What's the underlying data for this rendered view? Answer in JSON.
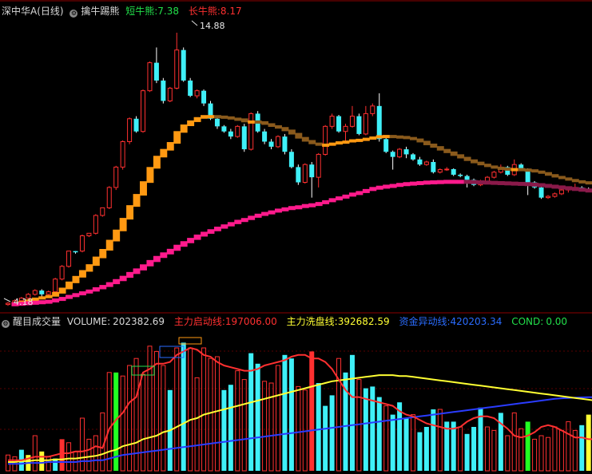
{
  "top_header": {
    "stock_name": "深中华A(日线)",
    "indicator_name": "擒牛踢熊",
    "short_label": "短牛熊:",
    "short_value": "7.38",
    "long_label": "长牛熊:",
    "long_value": "8.17"
  },
  "bottom_header": {
    "indicator_name": "醒目成交量",
    "volume_label": "VOLUME:",
    "volume_value": "202382.69",
    "start_label": "主力启动线:",
    "start_value": "197006.00",
    "wash_label": "主力洗盘线:",
    "wash_value": "392682.59",
    "fund_label": "资金异动线:",
    "fund_value": "420203.34",
    "cond_label": "COND:",
    "cond_value": "0.00"
  },
  "price_annotations": {
    "high": "14.88",
    "low": "4.18"
  },
  "colors": {
    "up": "#ff3030",
    "down": "#3ff0f8",
    "orange": "#ff9912",
    "brown": "#8a5a1c",
    "pink": "#ff1a8c",
    "maroon": "#8a1a4a",
    "yellow": "#ffff33",
    "blue": "#2a3cff",
    "green": "#22ff22"
  },
  "chart_data": [
    {
      "type": "candlestick",
      "price_range": [
        4.0,
        15.6
      ],
      "candles": [
        [
          4.2,
          4.25,
          4.15,
          4.3
        ],
        [
          4.25,
          4.35,
          4.2,
          4.4
        ],
        [
          4.35,
          4.45,
          4.3,
          4.5
        ],
        [
          4.45,
          4.6,
          4.4,
          4.65
        ],
        [
          4.6,
          4.75,
          4.55,
          4.8
        ],
        [
          4.75,
          4.6,
          4.5,
          4.8
        ],
        [
          4.6,
          4.7,
          4.55,
          4.75
        ],
        [
          4.7,
          5.2,
          4.65,
          5.25
        ],
        [
          5.2,
          5.7,
          5.15,
          5.75
        ],
        [
          5.7,
          6.3,
          5.65,
          6.3
        ],
        [
          6.3,
          6.25,
          6.2,
          6.3
        ],
        [
          6.3,
          6.9,
          6.25,
          6.95
        ],
        [
          6.9,
          7.0,
          6.85,
          7.0
        ],
        [
          7.0,
          7.7,
          6.95,
          7.75
        ],
        [
          7.7,
          8.0,
          7.65,
          8.0
        ],
        [
          8.0,
          8.8,
          7.95,
          8.85
        ],
        [
          8.8,
          9.6,
          8.7,
          9.65
        ],
        [
          9.6,
          10.6,
          9.5,
          10.65
        ],
        [
          10.6,
          11.5,
          10.5,
          11.55
        ],
        [
          11.5,
          11.0,
          10.95,
          11.6
        ],
        [
          11.0,
          12.6,
          10.95,
          12.65
        ],
        [
          12.6,
          13.7,
          12.55,
          13.75
        ],
        [
          13.7,
          13.0,
          12.9,
          14.3
        ],
        [
          13.0,
          12.2,
          12.1,
          13.1
        ],
        [
          12.2,
          12.7,
          12.15,
          12.75
        ],
        [
          12.7,
          14.2,
          12.65,
          14.88
        ],
        [
          14.2,
          13.0,
          12.95,
          14.3
        ],
        [
          13.0,
          12.4,
          12.35,
          13.1
        ],
        [
          12.4,
          12.6,
          12.3,
          12.65
        ],
        [
          12.6,
          12.1,
          12.0,
          12.65
        ],
        [
          12.1,
          11.5,
          11.45,
          12.2
        ],
        [
          11.5,
          11.2,
          11.1,
          11.55
        ],
        [
          11.2,
          11.0,
          10.95,
          11.25
        ],
        [
          11.0,
          10.8,
          10.7,
          11.1
        ],
        [
          10.8,
          11.2,
          10.75,
          11.25
        ],
        [
          11.2,
          10.3,
          10.2,
          11.3
        ],
        [
          10.3,
          11.7,
          10.25,
          11.75
        ],
        [
          11.7,
          11.0,
          10.95,
          11.8
        ],
        [
          11.0,
          10.6,
          10.5,
          11.1
        ],
        [
          10.6,
          10.4,
          10.3,
          10.7
        ],
        [
          10.4,
          10.8,
          10.35,
          10.85
        ],
        [
          10.8,
          10.2,
          10.1,
          10.9
        ],
        [
          10.2,
          9.6,
          9.55,
          10.3
        ],
        [
          9.6,
          9.0,
          8.9,
          9.7
        ],
        [
          9.0,
          9.7,
          8.95,
          9.75
        ],
        [
          9.7,
          9.2,
          8.4,
          9.8
        ],
        [
          9.2,
          10.1,
          8.8,
          10.15
        ],
        [
          10.1,
          11.2,
          10.05,
          11.25
        ],
        [
          11.2,
          11.6,
          11.1,
          11.7
        ],
        [
          11.6,
          11.0,
          10.95,
          11.65
        ],
        [
          11.0,
          11.2,
          10.6,
          11.3
        ],
        [
          11.2,
          11.6,
          11.15,
          12.0
        ],
        [
          11.6,
          10.9,
          10.85,
          11.7
        ],
        [
          10.9,
          11.7,
          10.85,
          12.0
        ],
        [
          11.7,
          12.0,
          11.6,
          12.1
        ],
        [
          12.0,
          10.7,
          10.6,
          12.5
        ],
        [
          10.7,
          10.2,
          10.15,
          10.8
        ],
        [
          10.2,
          10.0,
          9.5,
          10.25
        ],
        [
          10.0,
          10.3,
          9.95,
          10.35
        ],
        [
          10.3,
          10.1,
          9.95,
          10.4
        ],
        [
          10.1,
          9.9,
          9.85,
          10.15
        ],
        [
          9.9,
          9.7,
          9.65,
          10.0
        ],
        [
          9.7,
          9.8,
          9.65,
          9.85
        ],
        [
          9.8,
          9.4,
          9.35,
          9.9
        ],
        [
          9.4,
          9.5,
          9.35,
          9.55
        ],
        [
          9.5,
          9.52,
          9.45,
          9.6
        ],
        [
          9.52,
          9.3,
          9.25,
          9.55
        ],
        [
          9.3,
          9.25,
          9.2,
          9.35
        ],
        [
          9.25,
          9.1,
          8.8,
          9.3
        ],
        [
          9.1,
          8.9,
          8.85,
          9.15
        ],
        [
          8.9,
          9.05,
          8.85,
          9.1
        ],
        [
          9.05,
          9.2,
          9.0,
          9.25
        ],
        [
          9.2,
          9.4,
          9.15,
          9.45
        ],
        [
          9.4,
          9.6,
          9.35,
          9.7
        ],
        [
          9.6,
          9.3,
          9.25,
          9.65
        ],
        [
          9.3,
          9.7,
          9.25,
          9.9
        ],
        [
          9.7,
          9.5,
          9.45,
          9.75
        ],
        [
          9.5,
          9.0,
          8.5,
          9.55
        ],
        [
          9.0,
          8.8,
          8.75,
          9.05
        ],
        [
          8.8,
          8.4,
          8.35,
          8.85
        ],
        [
          8.4,
          8.45,
          8.35,
          8.5
        ],
        [
          8.45,
          8.55,
          8.4,
          8.6
        ],
        [
          8.55,
          8.7,
          8.5,
          8.75
        ],
        [
          8.7,
          8.75,
          8.6,
          8.8
        ],
        [
          8.75,
          8.8,
          8.7,
          8.95
        ],
        [
          8.8,
          8.75,
          8.7,
          8.85
        ],
        [
          8.75,
          8.7,
          8.65,
          8.8
        ],
        [
          8.7,
          8.72,
          8.6,
          8.8
        ]
      ],
      "short_line": [
        4.2,
        4.23,
        4.28,
        4.34,
        4.41,
        4.46,
        4.51,
        4.63,
        4.8,
        5.04,
        5.26,
        5.49,
        5.72,
        6.02,
        6.32,
        6.68,
        7.08,
        7.54,
        8.04,
        8.48,
        8.98,
        9.54,
        9.98,
        10.25,
        10.52,
        10.95,
        11.21,
        11.37,
        11.5,
        11.58,
        11.58,
        11.56,
        11.53,
        11.48,
        11.45,
        11.36,
        11.37,
        11.34,
        11.26,
        11.18,
        11.11,
        11.01,
        10.88,
        10.72,
        10.6,
        10.5,
        10.45,
        10.46,
        10.5,
        10.55,
        10.58,
        10.63,
        10.65,
        10.69,
        10.74,
        10.79,
        10.8,
        10.78,
        10.76,
        10.72,
        10.66,
        10.57,
        10.46,
        10.36,
        10.25,
        10.15,
        10.04,
        9.94,
        9.84,
        9.75,
        9.67,
        9.6,
        9.55,
        9.52,
        9.5,
        9.5,
        9.48,
        9.45,
        9.4,
        9.34,
        9.26,
        9.19,
        9.13,
        9.07,
        9.02,
        8.98,
        8.94,
        8.91
      ],
      "long_line": [
        4.2,
        4.21,
        4.23,
        4.25,
        4.27,
        4.29,
        4.31,
        4.36,
        4.42,
        4.5,
        4.57,
        4.64,
        4.71,
        4.8,
        4.89,
        5.0,
        5.12,
        5.25,
        5.4,
        5.54,
        5.7,
        5.87,
        6.03,
        6.17,
        6.31,
        6.47,
        6.61,
        6.74,
        6.87,
        6.98,
        7.08,
        7.18,
        7.27,
        7.36,
        7.45,
        7.52,
        7.61,
        7.69,
        7.76,
        7.82,
        7.89,
        7.94,
        7.99,
        8.02,
        8.07,
        8.1,
        8.15,
        8.22,
        8.3,
        8.37,
        8.44,
        8.52,
        8.58,
        8.66,
        8.74,
        8.79,
        8.83,
        8.86,
        8.9,
        8.93,
        8.95,
        8.97,
        8.99,
        9.0,
        9.01,
        9.02,
        9.02,
        9.02,
        9.01,
        9.0,
        8.99,
        8.98,
        8.97,
        8.96,
        8.95,
        8.94,
        8.93,
        8.91,
        8.89,
        8.86,
        8.83,
        8.8,
        8.77,
        8.74,
        8.71,
        8.68,
        8.65,
        8.62
      ]
    },
    {
      "type": "bar",
      "volume_range": [
        0,
        800000
      ],
      "volumes": [
        90000,
        80000,
        120000,
        90000,
        200000,
        110000,
        80000,
        70000,
        180000,
        160000,
        110000,
        300000,
        180000,
        200000,
        330000,
        560000,
        560000,
        540000,
        600000,
        640000,
        550000,
        710000,
        680000,
        600000,
        460000,
        700000,
        730000,
        700000,
        530000,
        700000,
        640000,
        650000,
        460000,
        490000,
        570000,
        520000,
        670000,
        610000,
        510000,
        500000,
        600000,
        660000,
        640000,
        480000,
        460000,
        680000,
        500000,
        370000,
        430000,
        640000,
        560000,
        660000,
        520000,
        470000,
        480000,
        420000,
        370000,
        320000,
        390000,
        300000,
        320000,
        220000,
        250000,
        350000,
        350000,
        280000,
        280000,
        250000,
        210000,
        250000,
        360000,
        250000,
        230000,
        330000,
        200000,
        330000,
        240000,
        280000,
        180000,
        200000,
        190000,
        250000,
        230000,
        280000,
        230000,
        260000,
        320000,
        180000
      ],
      "bar_colors": [
        "red",
        "red",
        "down",
        "yellow",
        "red",
        "yellow",
        "red",
        "down",
        "redfill",
        "red",
        "red",
        "red",
        "red",
        "red",
        "red",
        "red",
        "green",
        "red",
        "red",
        "red",
        "red",
        "red",
        "red",
        "red",
        "down",
        "red",
        "down",
        "red",
        "red",
        "red",
        "red",
        "red",
        "down",
        "down",
        "red",
        "red",
        "down",
        "down",
        "red",
        "red",
        "red",
        "down",
        "down",
        "red",
        "red",
        "redfill",
        "down",
        "down",
        "down",
        "red",
        "down",
        "down",
        "red",
        "down",
        "down",
        "down",
        "red",
        "down",
        "down",
        "down",
        "red",
        "down",
        "down",
        "down",
        "red",
        "down",
        "down",
        "red",
        "down",
        "down",
        "down",
        "red",
        "red",
        "down",
        "red",
        "red",
        "red",
        "green",
        "red",
        "red",
        "red",
        "red",
        "red",
        "red",
        "red",
        "down",
        "yellow",
        "red"
      ],
      "start_line": [
        60000,
        60000,
        60000,
        70000,
        80000,
        80000,
        80000,
        90000,
        100000,
        100000,
        110000,
        110000,
        120000,
        140000,
        130000,
        240000,
        290000,
        330000,
        390000,
        420000,
        560000,
        580000,
        610000,
        610000,
        620000,
        660000,
        680000,
        700000,
        690000,
        660000,
        650000,
        620000,
        600000,
        590000,
        580000,
        570000,
        570000,
        580000,
        600000,
        610000,
        620000,
        630000,
        650000,
        660000,
        660000,
        640000,
        640000,
        620000,
        580000,
        520000,
        460000,
        420000,
        420000,
        410000,
        400000,
        390000,
        380000,
        370000,
        340000,
        320000,
        310000,
        290000,
        270000,
        260000,
        250000,
        240000,
        240000,
        250000,
        280000,
        300000,
        310000,
        310000,
        300000,
        270000,
        240000,
        200000,
        190000,
        200000,
        220000,
        250000,
        260000,
        250000,
        230000,
        210000,
        190000,
        190000,
        180000,
        180000
      ],
      "wash_line": [
        50000,
        50000,
        55000,
        55000,
        60000,
        60000,
        60000,
        65000,
        65000,
        70000,
        70000,
        75000,
        80000,
        85000,
        95000,
        110000,
        120000,
        140000,
        150000,
        160000,
        180000,
        190000,
        200000,
        220000,
        230000,
        250000,
        270000,
        290000,
        300000,
        320000,
        330000,
        340000,
        350000,
        360000,
        370000,
        380000,
        390000,
        400000,
        410000,
        420000,
        430000,
        440000,
        450000,
        460000,
        470000,
        480000,
        490000,
        500000,
        510000,
        515000,
        520000,
        525000,
        530000,
        535000,
        540000,
        545000,
        545000,
        545000,
        540000,
        540000,
        535000,
        530000,
        525000,
        520000,
        515000,
        510000,
        505000,
        500000,
        495000,
        490000,
        485000,
        480000,
        475000,
        470000,
        465000,
        460000,
        455000,
        450000,
        445000,
        440000,
        435000,
        430000,
        425000,
        420000,
        415000,
        410000,
        405000,
        400000
      ],
      "fund_line": [
        40000,
        40000,
        40000,
        45000,
        45000,
        45000,
        50000,
        50000,
        50000,
        50000,
        50000,
        55000,
        55000,
        60000,
        60000,
        70000,
        80000,
        90000,
        95000,
        100000,
        105000,
        110000,
        115000,
        120000,
        125000,
        130000,
        135000,
        140000,
        145000,
        150000,
        155000,
        160000,
        165000,
        170000,
        175000,
        180000,
        185000,
        190000,
        195000,
        200000,
        205000,
        210000,
        215000,
        220000,
        225000,
        230000,
        235000,
        240000,
        245000,
        250000,
        255000,
        260000,
        265000,
        270000,
        275000,
        280000,
        285000,
        290000,
        295000,
        300000,
        305000,
        310000,
        315000,
        320000,
        325000,
        330000,
        335000,
        340000,
        345000,
        350000,
        355000,
        360000,
        365000,
        370000,
        375000,
        380000,
        385000,
        390000,
        395000,
        400000,
        405000,
        410000,
        413000,
        415000,
        417000,
        418000,
        419000,
        420000
      ]
    }
  ]
}
